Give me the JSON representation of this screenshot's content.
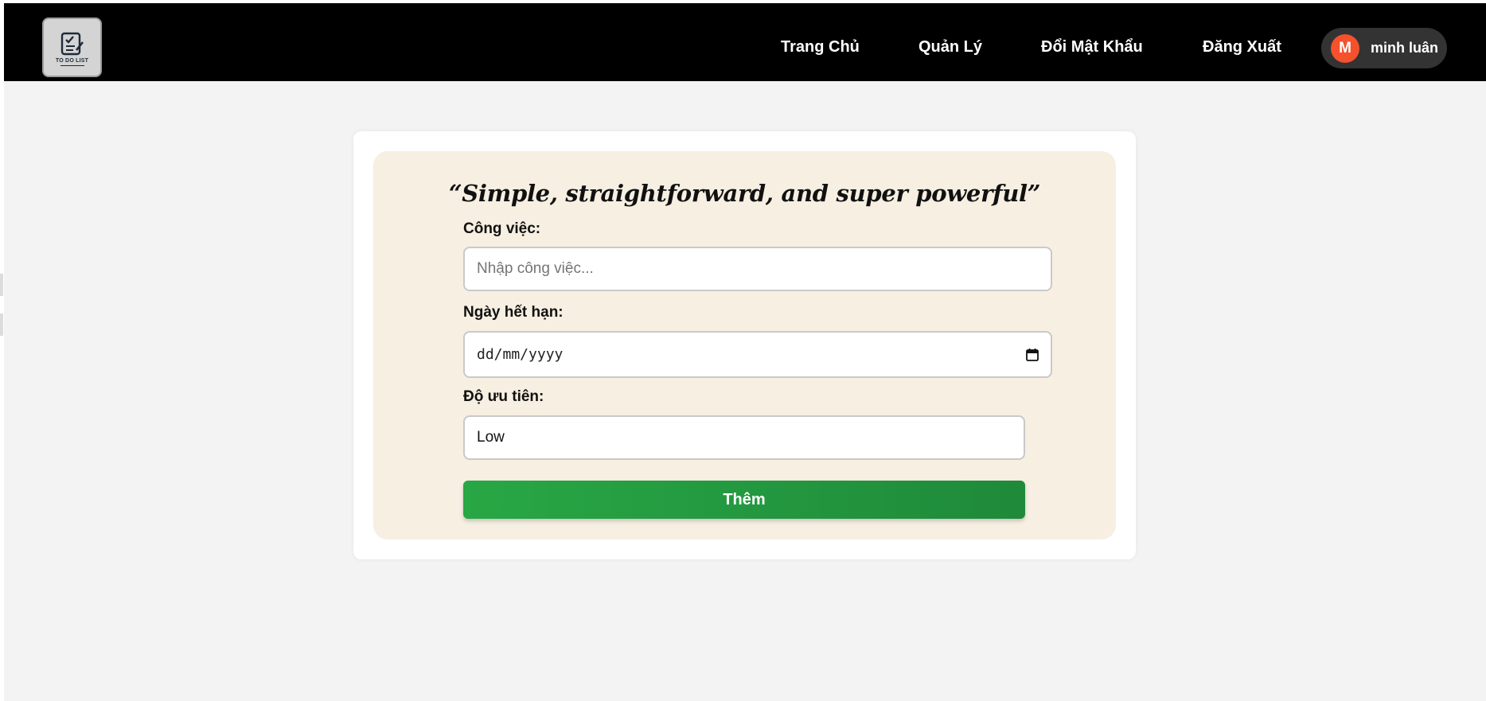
{
  "header": {
    "logo_text": "TO DO LIST",
    "nav": [
      {
        "label": "Trang Chủ"
      },
      {
        "label": "Quản Lý"
      },
      {
        "label": "Đổi Mật Khẩu"
      },
      {
        "label": "Đăng Xuất"
      }
    ],
    "user": {
      "initial": "M",
      "name": "minh luân"
    }
  },
  "form": {
    "quote": "“Simple, straightforward, and super powerful”",
    "task_label": "Công việc:",
    "task_placeholder": "Nhập công việc...",
    "task_value": "",
    "due_label": "Ngày hết hạn:",
    "due_placeholder": "dd/mm/yyyy",
    "priority_label": "Độ ưu tiên:",
    "priority_value": "Low",
    "submit_label": "Thêm"
  },
  "colors": {
    "navbar": "#000000",
    "accent_green": "#28a745",
    "avatar": "#f4512c",
    "panel": "#f6efe2"
  },
  "icons": [
    "todo-list-logo-icon",
    "calendar-icon"
  ]
}
